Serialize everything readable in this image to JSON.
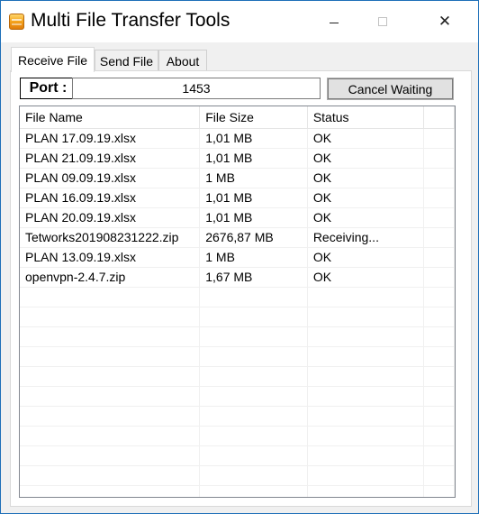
{
  "window": {
    "title": "Multi File Transfer Tools",
    "controls": {
      "minimize": "minimize",
      "maximize": "maximize",
      "close": "✕"
    }
  },
  "tabs": [
    {
      "label": "Receive File",
      "active": true
    },
    {
      "label": "Send File",
      "active": false
    },
    {
      "label": "About",
      "active": false
    }
  ],
  "receive": {
    "port_label": "Port :",
    "port_value": "1453",
    "cancel_label": "Cancel Waiting"
  },
  "table": {
    "columns": [
      "File Name",
      "File Size",
      "Status"
    ],
    "rows": [
      [
        "PLAN 17.09.19.xlsx",
        "1,01 MB",
        "OK"
      ],
      [
        "PLAN 21.09.19.xlsx",
        "1,01 MB",
        "OK"
      ],
      [
        "PLAN 09.09.19.xlsx",
        "1 MB",
        "OK"
      ],
      [
        "PLAN 16.09.19.xlsx",
        "1,01 MB",
        "OK"
      ],
      [
        "PLAN 20.09.19.xlsx",
        "1,01 MB",
        "OK"
      ],
      [
        "Tetworks201908231222.zip",
        "2676,87 MB",
        "Receiving..."
      ],
      [
        "PLAN 13.09.19.xlsx",
        "1 MB",
        "OK"
      ],
      [
        "openvpn-2.4.7.zip",
        "1,67 MB",
        "OK"
      ]
    ]
  },
  "colors": {
    "window_border": "#1e6fb8",
    "button_face": "#e1e1e1"
  }
}
